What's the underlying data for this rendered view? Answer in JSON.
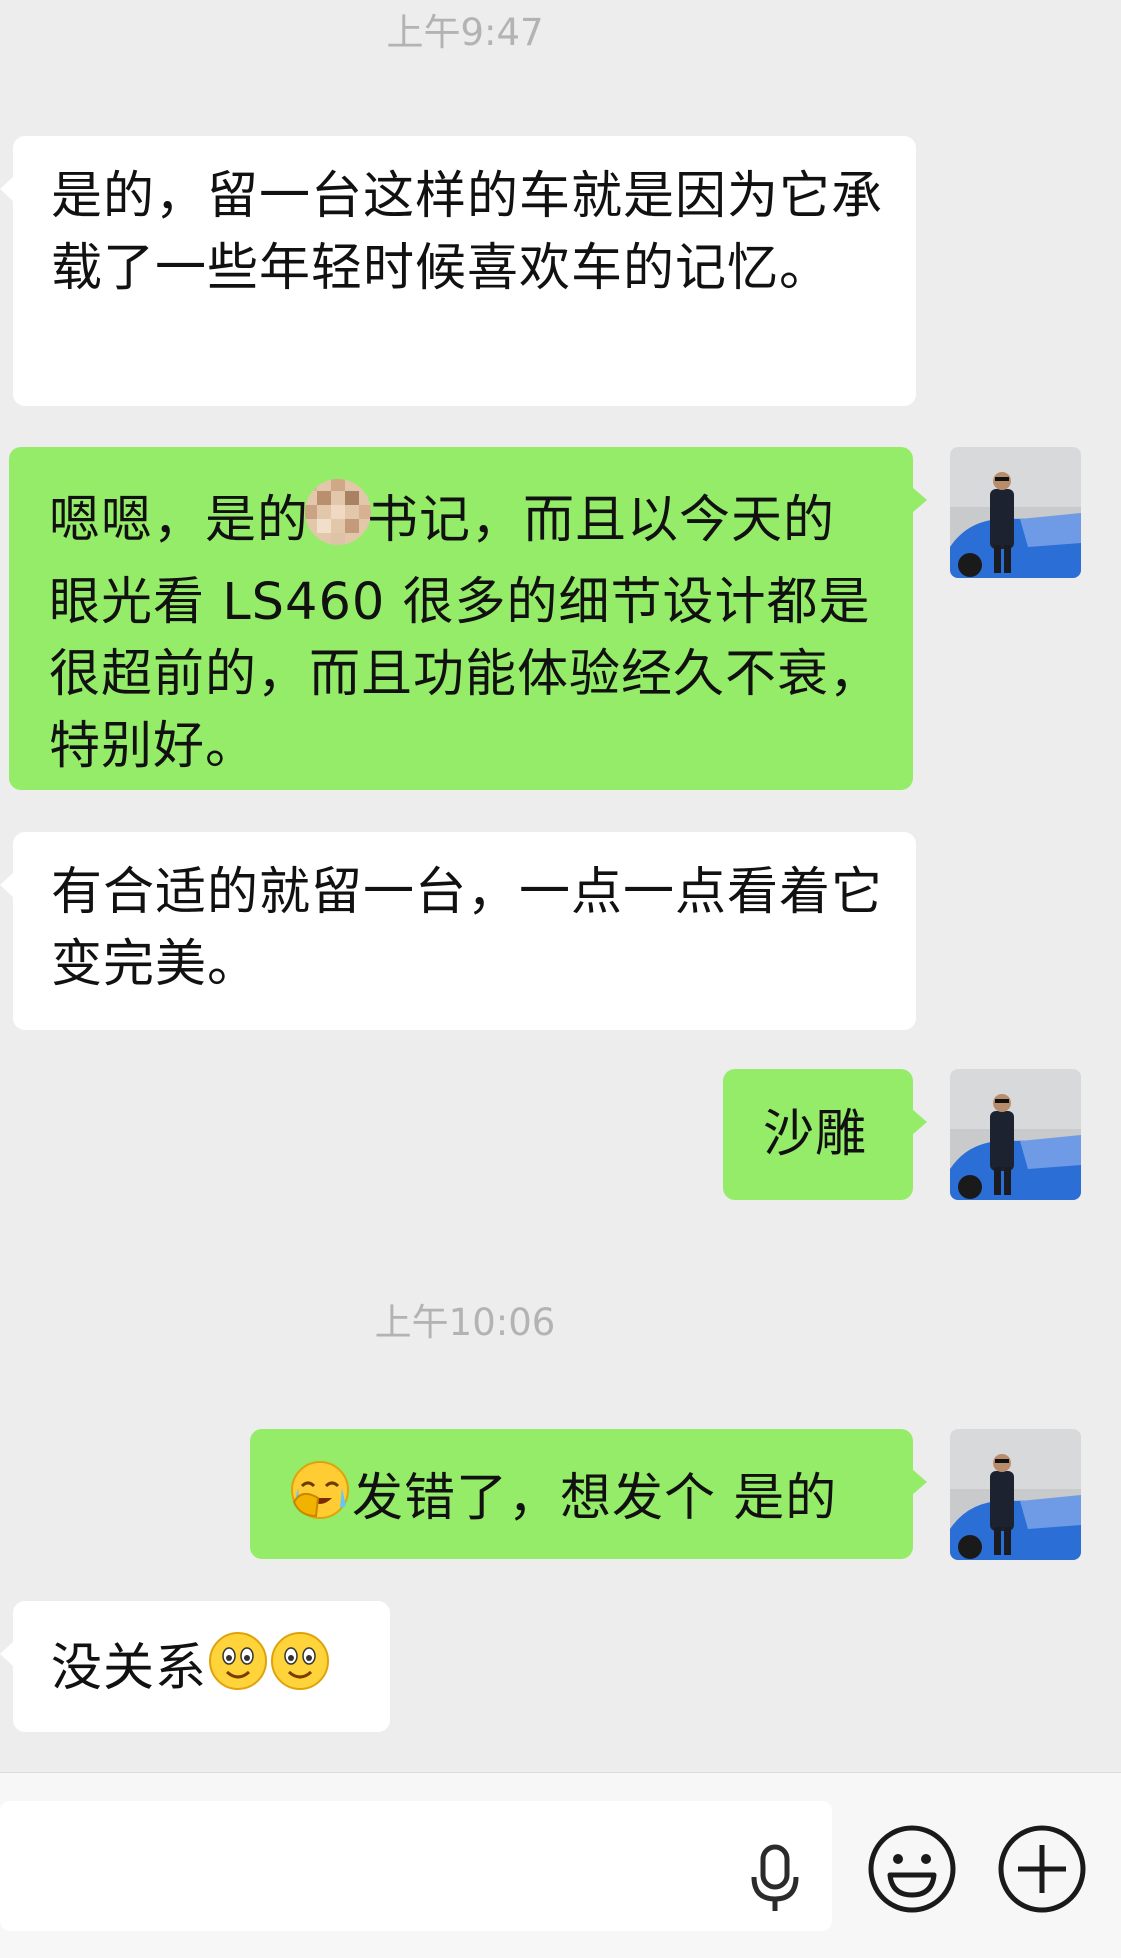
{
  "conversation": {
    "timestamps": [
      "上午9:47",
      "上午10:06"
    ],
    "messages": [
      {
        "side": "received",
        "text": "是的，留一台这样的车就是因为它承载了一些年轻时候喜欢车的记忆。"
      },
      {
        "side": "sent",
        "text_before": "嗯嗯，是的",
        "text_after": "书记，而且以今天的眼光看 LS460 很多的细节设计都是很超前的，而且功能体验经久不衰，特别好。",
        "censored": true
      },
      {
        "side": "received",
        "text": "有合适的就留一台，一点一点看着它变完美。"
      },
      {
        "side": "sent",
        "text": "沙雕"
      },
      {
        "side": "sent",
        "emoji": "face-palm-crying",
        "text": "发错了，想发个 是的"
      },
      {
        "side": "received",
        "text": "没关系",
        "emojis": [
          "smiley-face",
          "smiley-face"
        ]
      }
    ]
  },
  "composer": {
    "input_value": "",
    "icons": [
      "microphone-icon",
      "emoji-icon",
      "plus-icon"
    ]
  },
  "colors": {
    "background": "#ededed",
    "sent_bubble": "#95ec69",
    "received_bubble": "#ffffff",
    "timestamp": "#b3b3b3"
  }
}
